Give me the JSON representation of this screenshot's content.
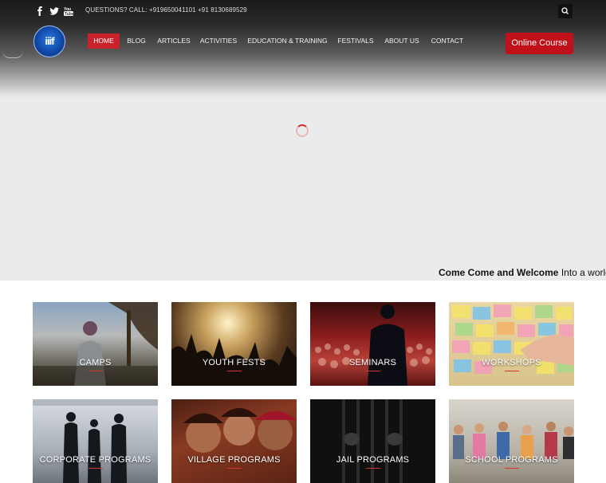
{
  "topbar": {
    "social_icons": [
      {
        "name": "facebook-icon",
        "glyph": "f"
      },
      {
        "name": "twitter-icon",
        "glyph": "t"
      },
      {
        "name": "youtube-icon",
        "glyph": "▶"
      }
    ],
    "contact_text": "QUESTIONS? CALL: +919650041101 +91 8130689529",
    "search_icon": "search-icon"
  },
  "logo": {
    "letters": "iiif"
  },
  "nav": {
    "items": [
      {
        "label": "HOME",
        "active": true
      },
      {
        "label": "BLOG"
      },
      {
        "label": "ARTICLES"
      },
      {
        "label": "ACTIVITIES"
      },
      {
        "label": "EDUCATION & TRAINING"
      },
      {
        "label": "FESTIVALS"
      },
      {
        "label": "ABOUT US"
      },
      {
        "label": "CONTACT"
      }
    ],
    "cta_label": "Online Course"
  },
  "hero": {
    "marquee_bold": "Come Come and Welcome",
    "marquee_rest": " Into a world"
  },
  "programs": [
    {
      "label": "CAMPS"
    },
    {
      "label": "YOUTH FESTS"
    },
    {
      "label": "SEMINARS"
    },
    {
      "label": "WORKSHOPS"
    },
    {
      "label": "CORPORATE PROGRAMS"
    },
    {
      "label": "VILLAGE PROGRAMS"
    },
    {
      "label": "JAIL PROGRAMS"
    },
    {
      "label": "SCHOOL PROGRAMS"
    }
  ],
  "colors": {
    "accent": "#c9222b",
    "cta": "#c0111b"
  }
}
